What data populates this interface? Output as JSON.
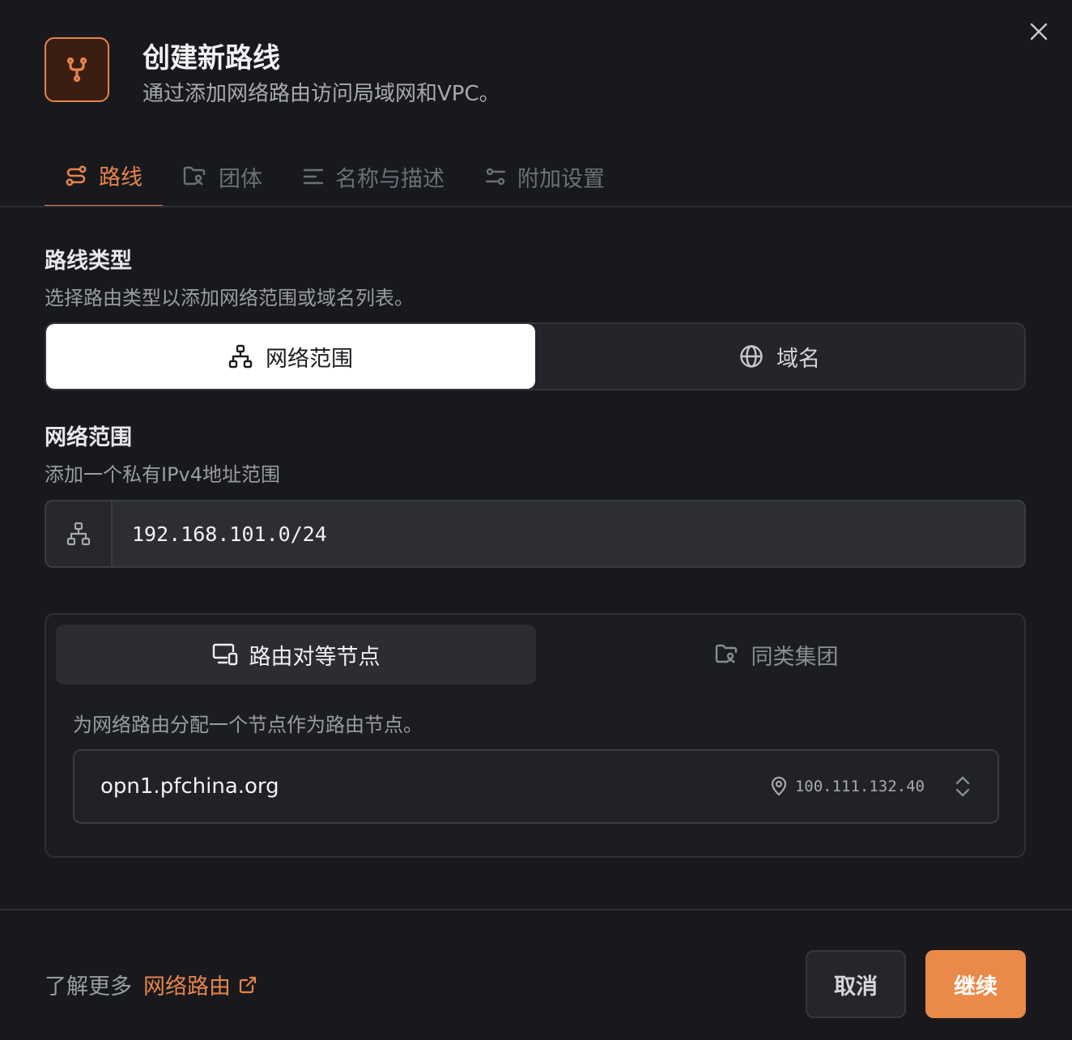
{
  "dialog": {
    "title": "创建新路线",
    "subtitle": "通过添加网络路由访问局域网和VPC。",
    "header_icon": "git-fork-icon",
    "close_icon": "close-icon"
  },
  "tabs": [
    {
      "label": "路线",
      "icon": "route-icon",
      "active": true
    },
    {
      "label": "团体",
      "icon": "folder-users-icon",
      "active": false
    },
    {
      "label": "名称与描述",
      "icon": "text-align-icon",
      "active": false
    },
    {
      "label": "附加设置",
      "icon": "settings-sliders-icon",
      "active": false
    }
  ],
  "route_type": {
    "title": "路线类型",
    "description": "选择路由类型以添加网络范围或域名列表。",
    "options": [
      {
        "label": "网络范围",
        "icon": "network-icon",
        "selected": true
      },
      {
        "label": "域名",
        "icon": "globe-icon",
        "selected": false
      }
    ]
  },
  "network_range": {
    "title": "网络范围",
    "description": "添加一个私有IPv4地址范围",
    "value": "192.168.101.0/24",
    "prefix_icon": "network-icon"
  },
  "routing": {
    "tabs": [
      {
        "label": "路由对等节点",
        "icon": "devices-icon",
        "active": true
      },
      {
        "label": "同类集团",
        "icon": "folder-users-icon",
        "active": false
      }
    ],
    "description": "为网络路由分配一个节点作为路由节点。",
    "selected_peer": {
      "name": "opn1.pfchina.org",
      "ip": "100.111.132.40",
      "ip_icon": "map-pin-icon",
      "chevron_icon": "chevrons-up-down-icon"
    }
  },
  "footer": {
    "learn_more_prefix": "了解更多",
    "learn_more_link": "网络路由",
    "link_icon": "external-link-icon",
    "cancel_label": "取消",
    "continue_label": "继续"
  },
  "colors": {
    "accent": "#ea8a4a",
    "background": "#18191d",
    "surface": "#23252a"
  }
}
